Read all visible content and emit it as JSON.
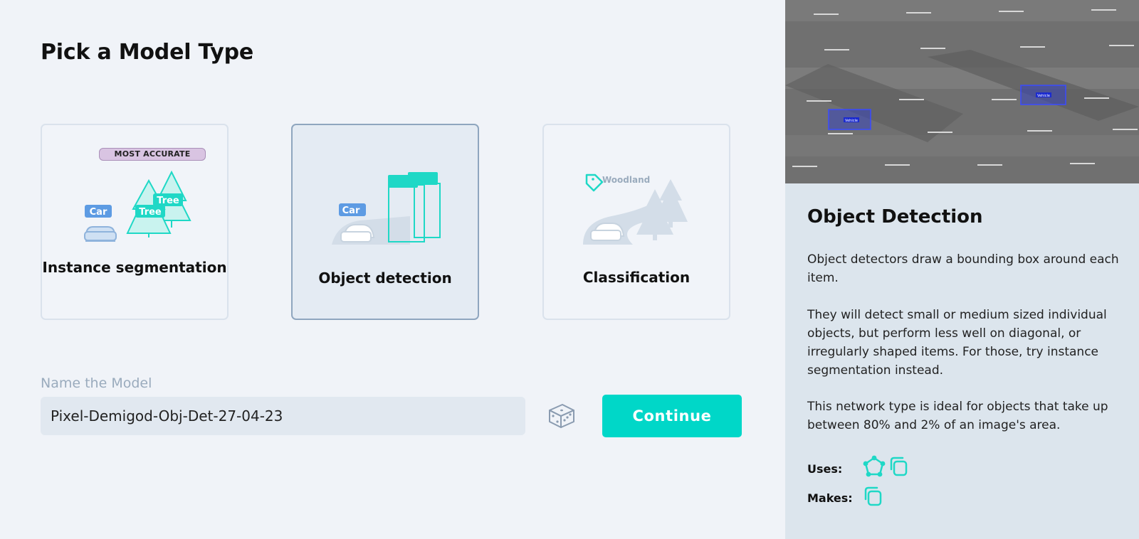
{
  "page": {
    "title": "Pick a Model Type"
  },
  "cards": {
    "instance": {
      "label": "Instance segmentation",
      "badge": "MOST ACCURATE",
      "car_tag": "Car",
      "tree_tag_1": "Tree",
      "tree_tag_2": "Tree"
    },
    "detection": {
      "label": "Object detection",
      "car_tag": "Car"
    },
    "classification": {
      "label": "Classification",
      "tag": "Woodland"
    }
  },
  "form": {
    "name_label": "Name the Model",
    "name_value": "Pixel-Demigod-Obj-Det-27-04-23",
    "continue_label": "Continue"
  },
  "panel": {
    "preview_tag_1": "Vehicle",
    "preview_tag_2": "Vehicle",
    "title": "Object Detection",
    "p1": "Object detectors draw a bounding box around each item.",
    "p2": "They will detect small or medium sized individual objects, but perform less well on diagonal, or irregularly shaped items. For those, try instance segmentation instead.",
    "p3": "This network type is ideal for objects that take up between 80% and 2% of an image's area.",
    "uses_label": "Uses:",
    "makes_label": "Makes:",
    "uses_icons": [
      "polygon-icon",
      "copy-icon"
    ],
    "makes_icons": [
      "copy-icon"
    ]
  },
  "colors": {
    "accent": "#00d7c8",
    "selected_border": "#8fa6bf",
    "panel_bg": "#dce5ed",
    "badge_bg": "#d9c4e2"
  }
}
